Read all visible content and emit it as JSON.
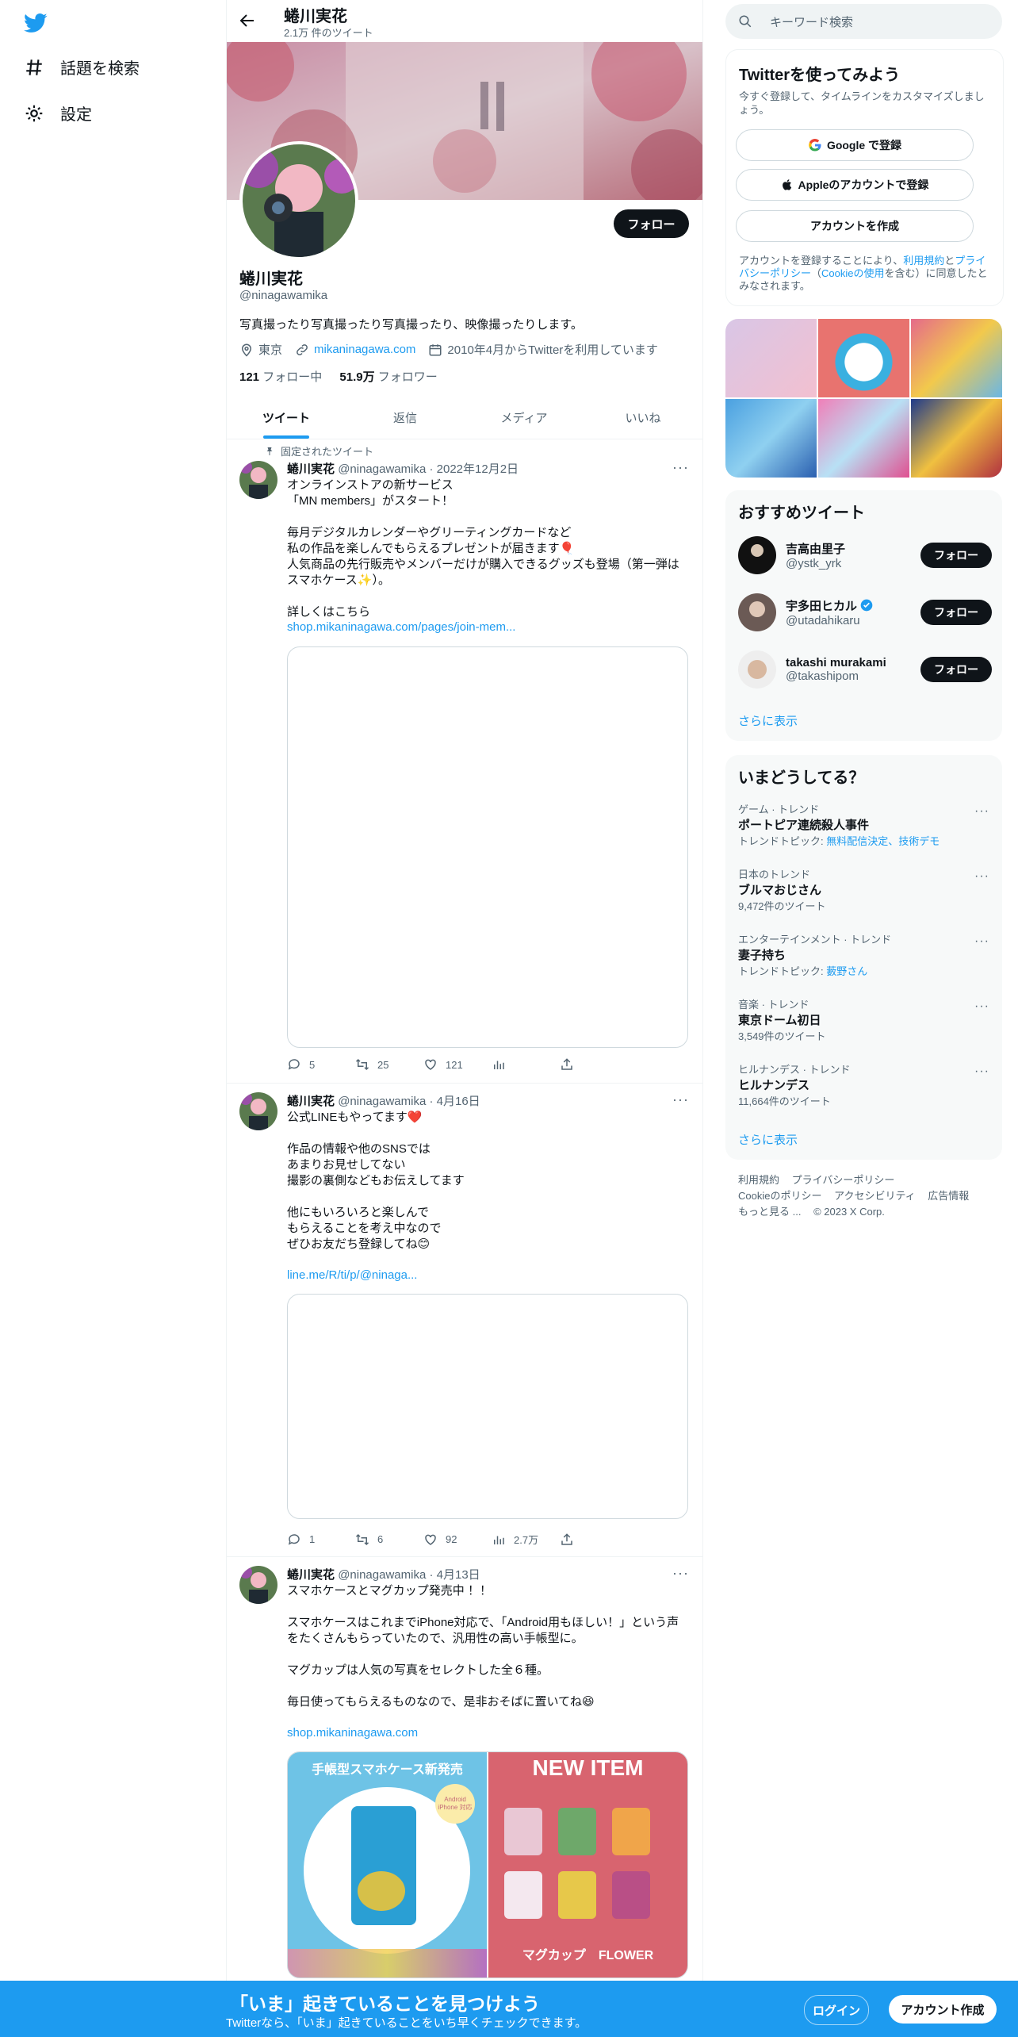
{
  "nav": {
    "logo": "twitter-bird-icon",
    "items": [
      {
        "label": "話題を検索",
        "icon": "hashtag-icon"
      },
      {
        "label": "設定",
        "icon": "gear-icon"
      }
    ]
  },
  "header": {
    "name": "蜷川実花",
    "count": "2.1万 件のツイート"
  },
  "profile": {
    "name": "蜷川実花",
    "handle": "@ninagawamika",
    "follow_label": "フォロー",
    "bio": "写真撮ったり写真撮ったり写真撮ったり、映像撮ったりします。",
    "location": "東京",
    "website": "mikaninagawa.com",
    "joined": "2010年4月からTwitterを利用しています",
    "following_count": "121",
    "following_label": "フォロー中",
    "followers_count": "51.9万",
    "followers_label": "フォロワー"
  },
  "tabs": [
    "ツイート",
    "返信",
    "メディア",
    "いいね"
  ],
  "pinned_label": "固定されたツイート",
  "tweets": [
    {
      "name": "蜷川実花",
      "handle": "@ninagawamika",
      "date": "2022年12月2日",
      "text": "オンラインストアの新サービス\n「MN members」がスタート！\n\n毎月デジタルカレンダーやグリーティングカードなど\n私の作品を楽しんでもらえるプレゼントが届きます🎈\n人気商品の先行販売やメンバーだけが購入できるグッズも登場（第一弾はスマホケース✨）。\n\n詳しくはこちら",
      "link": "shop.mikaninagawa.com/pages/join-mem...",
      "replies": "5",
      "retweets": "25",
      "likes": "121",
      "views": ""
    },
    {
      "name": "蜷川実花",
      "handle": "@ninagawamika",
      "date": "4月16日",
      "text": "公式LINEもやってます❤️\n\n作品の情報や他のSNSでは\nあまりお見せしてない\n撮影の裏側などもお伝えしてます\n\n他にもいろいろと楽しんで\nもらえることを考え中なので\nぜひお友だち登録してね😊",
      "link": "line.me/R/ti/p/@ninaga...",
      "replies": "1",
      "retweets": "6",
      "likes": "92",
      "views": "2.7万"
    },
    {
      "name": "蜷川実花",
      "handle": "@ninagawamika",
      "date": "4月13日",
      "text": "スマホケースとマグカップ発売中 ！！\n\nスマホケースはこれまでiPhone対応で、「Android用もほしい！」という声をたくさんもらっていたので、汎用性の高い手帳型に。\n\nマグカップは人気の写真をセレクトした全６種。\n\n毎日使ってもらえるものなので、是非おそばに置いてね😆",
      "link": "shop.mikaninagawa.com",
      "img1_title": "手帳型スマホケース新発売",
      "img1_badge": "Android iPhone 対応",
      "img2_title": "NEW ITEM",
      "img2_caption": "マグカップ　FLOWER"
    }
  ],
  "search": {
    "placeholder": "キーワード検索"
  },
  "signup": {
    "title": "Twitterを使ってみよう",
    "subtitle": "今すぐ登録して、タイムラインをカスタマイズしましょう。",
    "google": "Google で登録",
    "apple": "Appleのアカウントで登録",
    "create": "アカウントを作成",
    "legal_pre": "アカウントを登録することにより、",
    "legal_terms": "利用規約",
    "legal_and": "と",
    "legal_privacy": "プライバシーポリシー",
    "legal_mid": "（",
    "legal_cookie": "Cookieの使用",
    "legal_post": "を含む）に同意したとみなされます。"
  },
  "recommended": {
    "title": "おすすめツイート",
    "users": [
      {
        "name": "吉高由里子",
        "handle": "@ystk_yrk",
        "verified": false
      },
      {
        "name": "宇多田ヒカル",
        "handle": "@utadahikaru",
        "verified": true
      },
      {
        "name": "takashi murakami",
        "handle": "@takashipom",
        "verified": false
      }
    ],
    "follow_label": "フォロー",
    "more": "さらに表示"
  },
  "trends": {
    "title": "いまどうしてる？",
    "items": [
      {
        "category": "ゲーム · トレンド",
        "name": "ポートピア連続殺人事件",
        "sub_prefix": "トレンドトピック: ",
        "sub_link": "無料配信決定、技術デモ",
        "sub": ""
      },
      {
        "category": "日本のトレンド",
        "name": "ブルマおじさん",
        "sub_prefix": "",
        "sub_link": "",
        "sub": "9,472件のツイート"
      },
      {
        "category": "エンターテインメント · トレンド",
        "name": "妻子持ち",
        "sub_prefix": "トレンドトピック: ",
        "sub_link": "藪野さん",
        "sub": ""
      },
      {
        "category": "音楽 · トレンド",
        "name": "東京ドーム初日",
        "sub_prefix": "",
        "sub_link": "",
        "sub": "3,549件のツイート"
      },
      {
        "category": "ヒルナンデス · トレンド",
        "name": "ヒルナンデス",
        "sub_prefix": "",
        "sub_link": "",
        "sub": "11,664件のツイート"
      }
    ],
    "more": "さらに表示"
  },
  "footer": {
    "links": [
      "利用規約",
      "プライバシーポリシー",
      "Cookieのポリシー",
      "アクセシビリティ",
      "広告情報",
      "もっと見る ..."
    ],
    "copyright": "© 2023 X Corp."
  },
  "bottom_bar": {
    "title": "「いま」起きていることを見つけよう",
    "subtitle": "Twitterなら、「いま」起きていることをいち早くチェックできます。",
    "login": "ログイン",
    "signup": "アカウント作成"
  },
  "colors": {
    "accent": "#1d9bf0",
    "text": "#0f1419",
    "muted": "#536471",
    "bottom_bar": "#1d9bf0"
  }
}
